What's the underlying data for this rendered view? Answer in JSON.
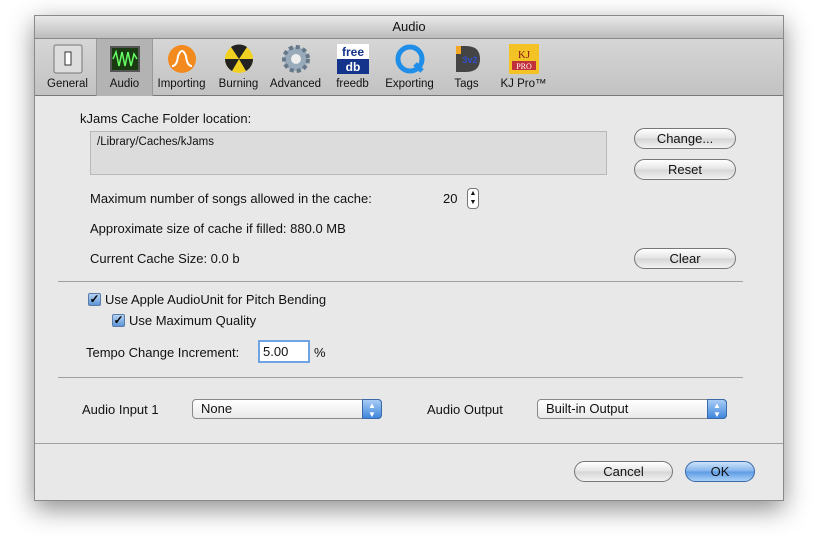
{
  "window": {
    "title": "Audio"
  },
  "toolbar": {
    "items": [
      {
        "label": "General",
        "icon": "switch-icon"
      },
      {
        "label": "Audio",
        "icon": "oscilloscope-icon",
        "selected": true
      },
      {
        "label": "Importing",
        "icon": "waveform-orange-icon"
      },
      {
        "label": "Burning",
        "icon": "radiation-icon"
      },
      {
        "label": "Advanced",
        "icon": "gear-icon"
      },
      {
        "label": "freedb",
        "icon": "freedb-logo-icon"
      },
      {
        "label": "Exporting",
        "icon": "quicktime-icon"
      },
      {
        "label": "Tags",
        "icon": "id3v2-icon"
      },
      {
        "label": "KJ Pro™",
        "icon": "kj-pro-logo-icon"
      }
    ]
  },
  "cache": {
    "folder_label": "kJams Cache Folder location:",
    "folder_path": "/Library/Caches/kJams",
    "change_label": "Change...",
    "reset_label": "Reset",
    "max_songs_label": "Maximum number of songs allowed in the cache:",
    "max_songs_value": "20",
    "approx_size": "Approximate size of cache if filled: 880.0 MB",
    "current_size": "Current Cache Size: 0.0 b",
    "clear_label": "Clear"
  },
  "audiounit": {
    "use_label": "Use Apple AudioUnit for Pitch Bending",
    "use_checked": true,
    "max_quality_label": "Use Maximum Quality",
    "max_quality_checked": true,
    "tempo_label": "Tempo Change Increment:",
    "tempo_value": "5.00",
    "tempo_unit": "%"
  },
  "io": {
    "input_label": "Audio Input 1",
    "input_value": "None",
    "output_label": "Audio Output",
    "output_value": "Built-in Output"
  },
  "footer": {
    "cancel_label": "Cancel",
    "ok_label": "OK"
  },
  "colors": {
    "accent": "#5c9ae3"
  }
}
